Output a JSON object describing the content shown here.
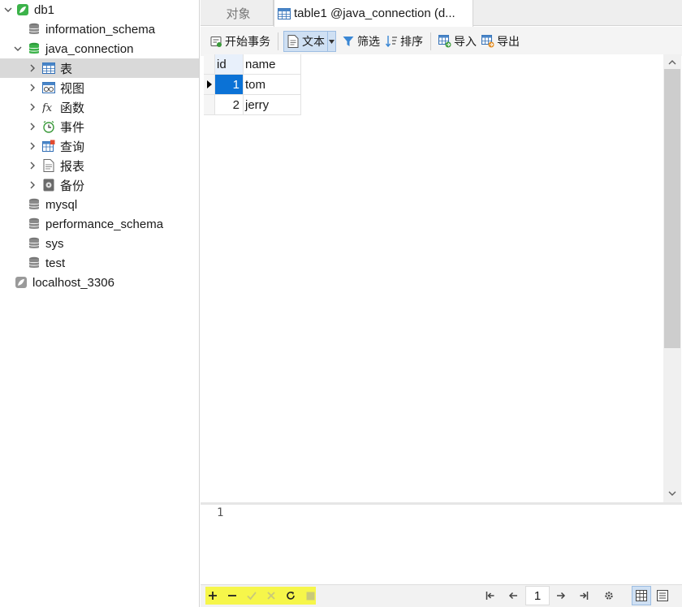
{
  "sidebar": {
    "connection_db1": "db1",
    "db_information_schema": "information_schema",
    "db_java_connection": "java_connection",
    "nodes": [
      {
        "label": "表",
        "icon": "table-icon"
      },
      {
        "label": "视图",
        "icon": "view-icon"
      },
      {
        "label": "函数",
        "icon": "function-icon"
      },
      {
        "label": "事件",
        "icon": "event-icon"
      },
      {
        "label": "查询",
        "icon": "query-icon"
      },
      {
        "label": "报表",
        "icon": "report-icon"
      },
      {
        "label": "备份",
        "icon": "backup-icon"
      }
    ],
    "db_mysql": "mysql",
    "db_performance_schema": "performance_schema",
    "db_sys": "sys",
    "db_test": "test",
    "connection_localhost": "localhost_3306"
  },
  "tabs": {
    "objects": "对象",
    "table_tab": "table1 @java_connection (d..."
  },
  "toolbar": {
    "begin_transaction": "开始事务",
    "text": "文本",
    "filter": "筛选",
    "sort": "排序",
    "import": "导入",
    "export": "导出"
  },
  "grid": {
    "columns": [
      "id",
      "name"
    ],
    "rows": [
      {
        "id": "1",
        "name": "tom"
      },
      {
        "id": "2",
        "name": "jerry"
      }
    ]
  },
  "sql_panel": {
    "line_number": "1"
  },
  "statusbar": {
    "page": "1"
  },
  "colors": {
    "selection": "#0b72d6",
    "highlight": "#f6f64a",
    "navicat_green": "#3cb34a"
  }
}
